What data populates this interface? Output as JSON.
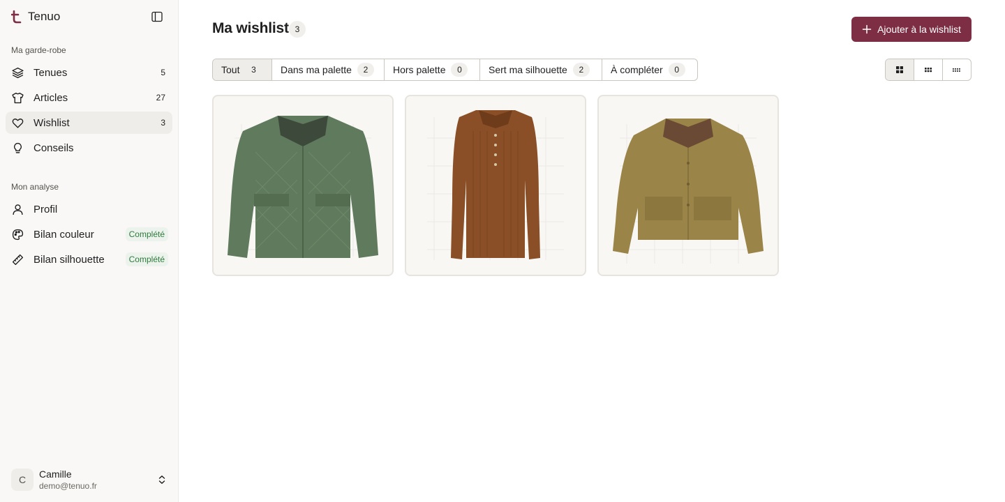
{
  "app": {
    "name": "Tenuo"
  },
  "sidebar": {
    "section1_label": "Ma garde-robe",
    "items": [
      {
        "label": "Tenues",
        "count": "5",
        "icon": "layers-icon"
      },
      {
        "label": "Articles",
        "count": "27",
        "icon": "shirt-icon"
      },
      {
        "label": "Wishlist",
        "count": "3",
        "icon": "heart-icon",
        "active": true
      },
      {
        "label": "Conseils",
        "count": "",
        "icon": "lightbulb-icon"
      }
    ],
    "section2_label": "Mon analyse",
    "analysis": [
      {
        "label": "Profil",
        "badge": "",
        "icon": "user-icon"
      },
      {
        "label": "Bilan couleur",
        "badge": "Complété",
        "icon": "palette-icon"
      },
      {
        "label": "Bilan silhouette",
        "badge": "Complété",
        "icon": "ruler-icon"
      }
    ]
  },
  "user": {
    "initial": "C",
    "name": "Camille",
    "email": "demo@tenuo.fr"
  },
  "main": {
    "title": "Ma wishlist",
    "count": "3",
    "add_button_label": "Ajouter à la wishlist",
    "filters": [
      {
        "label": "Tout",
        "count": "3",
        "active": true
      },
      {
        "label": "Dans ma palette",
        "count": "2"
      },
      {
        "label": "Hors palette",
        "count": "0"
      },
      {
        "label": "Sert ma silhouette",
        "count": "2"
      },
      {
        "label": "À compléter",
        "count": "0"
      }
    ],
    "views": [
      "large-grid",
      "small-grid",
      "compact-list"
    ],
    "cards": [
      {
        "item": "quilted-jacket",
        "color": "#5f7a5c"
      },
      {
        "item": "ribbed-polo-sweater",
        "color": "#8a4f26"
      },
      {
        "item": "corduroy-collar-jacket",
        "color": "#9a8448"
      }
    ]
  },
  "colors": {
    "accent": "#7d2e44",
    "sidebar_bg": "#f9f8f6",
    "success": "#2f7a3d"
  }
}
